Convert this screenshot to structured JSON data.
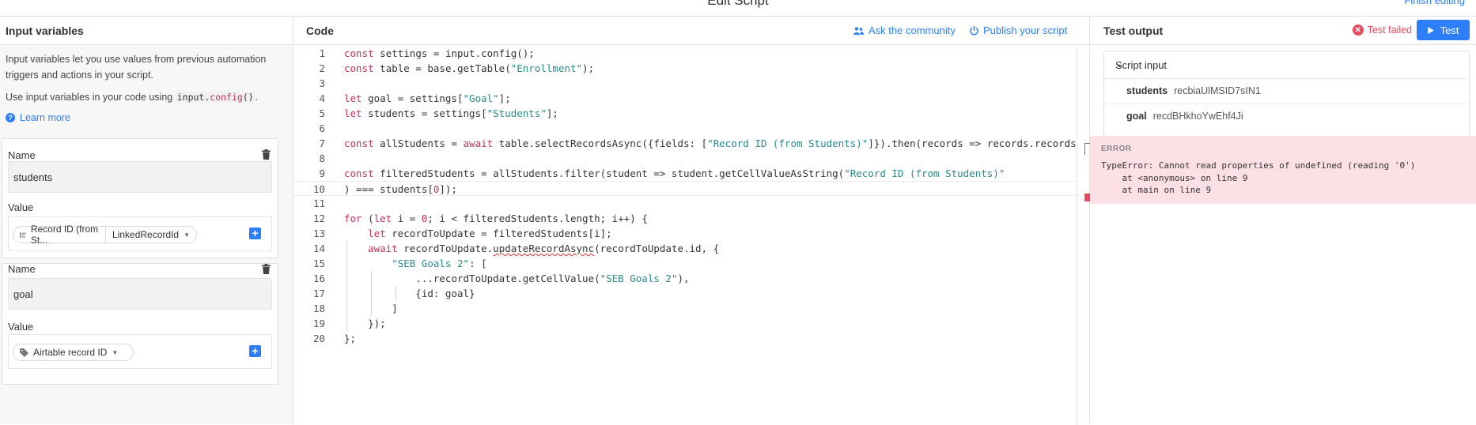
{
  "topbar": {
    "title": "Edit Script",
    "finish_label": "Finish editing"
  },
  "left": {
    "title": "Input variables",
    "description": "Input variables let you use values from previous automation triggers and actions in your script.",
    "usage_prefix": "Use input variables in your code using ",
    "usage_code_obj": "input.",
    "usage_code_fn": "config",
    "usage_code_parens": "()",
    "usage_suffix": ".",
    "learn_more": "Learn more",
    "variables": [
      {
        "name_label": "Name",
        "name": "students",
        "value_label": "Value",
        "value_field": "Record ID (from St...",
        "value_type": "LinkedRecordId"
      },
      {
        "name_label": "Name",
        "name": "goal",
        "value_label": "Value",
        "value_field": "Airtable record ID"
      }
    ]
  },
  "middle": {
    "title": "Code",
    "ask_community": "Ask the community",
    "publish": "Publish your script"
  },
  "code_lines": [
    {
      "n": "1",
      "t": "const settings = input.config();"
    },
    {
      "n": "2",
      "t": "const table = base.getTable(\"Enrollment\");"
    },
    {
      "n": "3",
      "t": ""
    },
    {
      "n": "4",
      "t": "let goal = settings[\"Goal\"];"
    },
    {
      "n": "5",
      "t": "let students = settings[\"Students\"];"
    },
    {
      "n": "6",
      "t": ""
    },
    {
      "n": "7",
      "t": "const allStudents = await table.selectRecordsAsync({fields: [\"Record ID (from Students)\"]}).then(records => records.records"
    },
    {
      "n": "8",
      "t": ""
    },
    {
      "n": "9",
      "t": "const filteredStudents = allStudents.filter(student => student.getCellValueAsString(\"Record ID (from Students)\""
    },
    {
      "n": "10",
      "t": ") === students[0]);"
    },
    {
      "n": "11",
      "t": ""
    },
    {
      "n": "12",
      "t": "for (let i = 0; i < filteredStudents.length; i++) {"
    },
    {
      "n": "13",
      "t": "let recordToUpdate = filteredStudents[i];"
    },
    {
      "n": "14",
      "t": "await recordToUpdate.updateRecordAsync(recordToUpdate.id, {"
    },
    {
      "n": "15",
      "t": "\"SEB Goals 2\": ["
    },
    {
      "n": "16",
      "t": "...recordToUpdate.getCellValue(\"SEB Goals 2\"),"
    },
    {
      "n": "17",
      "t": "{id: goal}"
    },
    {
      "n": "18",
      "t": "]"
    },
    {
      "n": "19",
      "t": "});"
    },
    {
      "n": "20",
      "t": "};"
    }
  ],
  "right": {
    "title": "Test output",
    "test_failed": "Test failed",
    "test_button": "Test",
    "script_input_label": "Script input",
    "inputs": [
      {
        "key": "students",
        "value": "recbiaUlMSID7sIN1"
      },
      {
        "key": "goal",
        "value": "recdBHkhoYwEhf4Ji"
      }
    ],
    "error_label": "ERROR",
    "error_message": "TypeError: Cannot read properties of undefined (reading '0')",
    "error_trace_1": "    at <anonymous> on line 9",
    "error_trace_2": "    at main on line 9"
  },
  "colors": {
    "accent": "#2d7ff9",
    "error": "#e84a5f",
    "error_bg": "#fde0e6",
    "keyword": "#c0365a",
    "string": "#2b8a8a"
  }
}
